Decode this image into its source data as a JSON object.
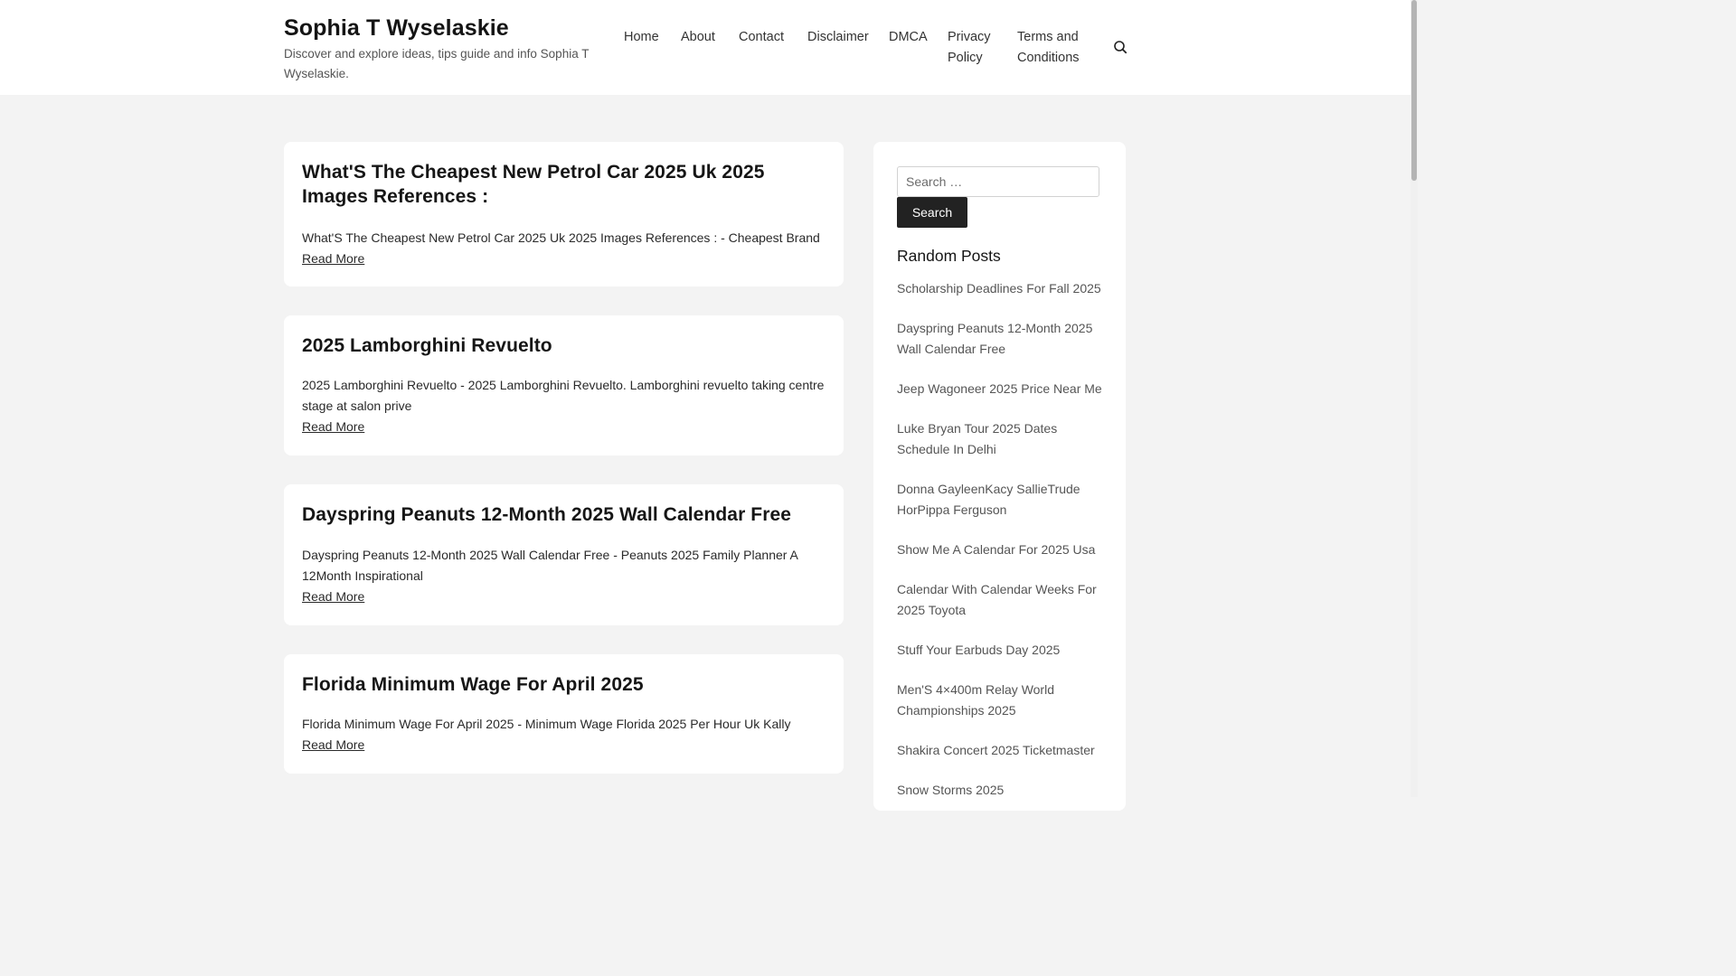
{
  "site": {
    "title": "Sophia T Wyselaskie",
    "description": "Discover and explore ideas, tips guide and info Sophia T Wyselaskie."
  },
  "nav": {
    "items": [
      {
        "label": "Home"
      },
      {
        "label": "About"
      },
      {
        "label": "Contact"
      },
      {
        "label": "Disclaimer"
      },
      {
        "label": "DMCA"
      },
      {
        "label": "Privacy Policy"
      },
      {
        "label": "Terms and Conditions"
      }
    ],
    "search_icon": "search-icon"
  },
  "posts": [
    {
      "title": "What'S The Cheapest New Petrol Car 2025 Uk 2025 Images References :",
      "excerpt": "What'S The Cheapest New Petrol Car 2025 Uk 2025 Images References : - Cheapest Brand",
      "read_more": "Read More"
    },
    {
      "title": "2025 Lamborghini Revuelto",
      "excerpt": "2025 Lamborghini Revuelto - 2025 Lamborghini Revuelto. Lamborghini revuelto taking centre stage at salon prive",
      "read_more": "Read More"
    },
    {
      "title": "Dayspring Peanuts 12-Month 2025 Wall Calendar Free",
      "excerpt": "Dayspring Peanuts 12-Month 2025 Wall Calendar Free - Peanuts 2025 Family Planner A 12Month Inspirational",
      "read_more": "Read More"
    },
    {
      "title": "Florida Minimum Wage For April 2025",
      "excerpt": "Florida Minimum Wage For April 2025 - Minimum Wage Florida 2025 Per Hour Uk Kally",
      "read_more": "Read More"
    }
  ],
  "sidebar": {
    "search": {
      "placeholder": "Search …",
      "button_label": "Search"
    },
    "random_posts": {
      "heading": "Random Posts",
      "items": [
        {
          "label": "Scholarship Deadlines For Fall 2025"
        },
        {
          "label": "Dayspring Peanuts 12-Month 2025 Wall Calendar Free"
        },
        {
          "label": "Jeep Wagoneer 2025 Price Near Me"
        },
        {
          "label": "Luke Bryan Tour 2025 Dates Schedule In Delhi"
        },
        {
          "label": "Donna GayleenKacy SallieTrude HorPippa Ferguson"
        },
        {
          "label": "Show Me A Calendar For 2025 Usa"
        },
        {
          "label": "Calendar With Calendar Weeks For 2025 Toyota"
        },
        {
          "label": "Stuff Your Earbuds Day 2025"
        },
        {
          "label": "Men'S 4×400m Relay World Championships 2025"
        },
        {
          "label": "Shakira Concert 2025 Ticketmaster"
        },
        {
          "label": "Snow Storms 2025"
        }
      ]
    }
  }
}
